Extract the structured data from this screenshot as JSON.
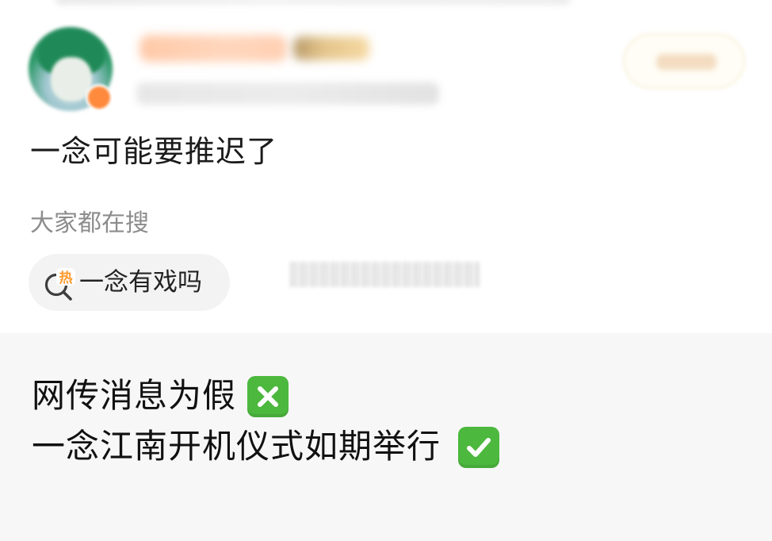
{
  "post": {
    "text": "一念可能要推迟了",
    "search_caption": "大家都在搜",
    "hot_search": {
      "badge_char": "热",
      "label": "一念有戏吗"
    }
  },
  "message": {
    "line1": "网传消息为假",
    "line2": "一念江南开机仪式如期举行"
  },
  "colors": {
    "background": "#f6f6f6",
    "card": "#ffffff",
    "text_primary": "#1b1b1b",
    "text_secondary": "#8c8c8c",
    "chip_bg": "#f3f3f3",
    "hot_orange": "#ff9a2e",
    "emoji_green": "#4cb83e"
  },
  "icons": {
    "hot_search": "hot-search-magnifier-icon",
    "cross": "cross-mark-button-icon",
    "check": "check-mark-button-icon"
  }
}
